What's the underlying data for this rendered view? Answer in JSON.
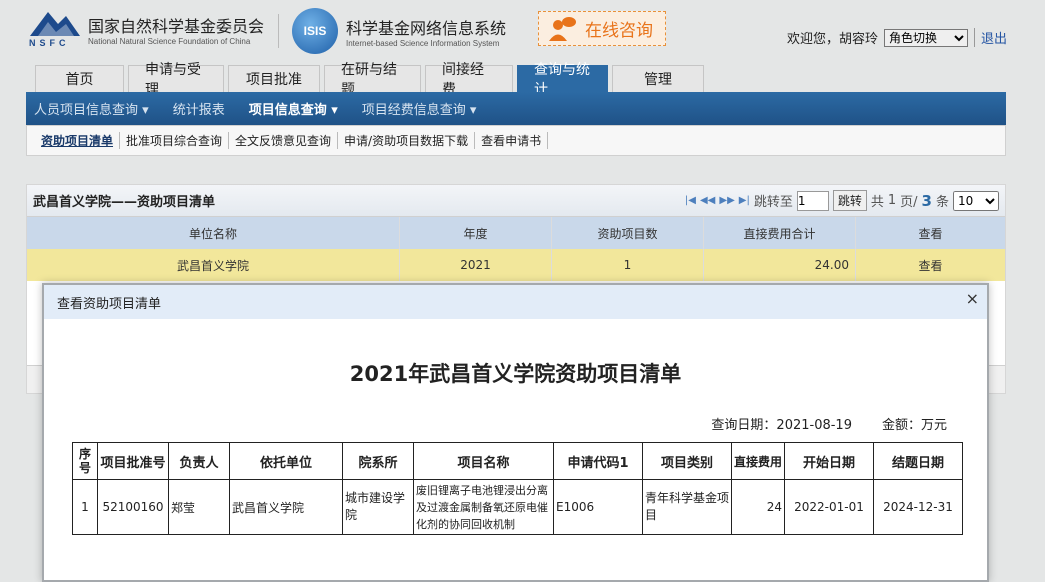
{
  "header": {
    "nsfc_abbr": "NSFC",
    "nsfc_name_cn": "国家自然科学基金委员会",
    "nsfc_name_en": "National Natural Science Foundation of China",
    "isis_abbr": "ISIS",
    "system_name_cn": "科学基金网络信息系统",
    "system_name_en": "Internet-based Science Information System",
    "consult_label": "在线咨询",
    "welcome": "欢迎您，胡容玲",
    "role_switch": "角色切换",
    "logout": "退出"
  },
  "tabs": [
    "首页",
    "申请与受理",
    "项目批准",
    "在研与结题",
    "间接经费",
    "查询与统计",
    "管理"
  ],
  "active_tab": 5,
  "nav": [
    "人员项目信息查询",
    "统计报表",
    "项目信息查询",
    "项目经费信息查询"
  ],
  "sub_nav": [
    "资助项目清单",
    "批准项目综合查询",
    "全文反馈意见查询",
    "申请/资助项目数据下载",
    "查看申请书"
  ],
  "panel": {
    "title": "武昌首义学院——资助项目清单",
    "pager": {
      "jump_to": "跳转至",
      "page_input": "1",
      "jump_button": "跳转",
      "total_prefix": "共",
      "total_pages": "1",
      "page_unit": "页/",
      "total_records": "3",
      "record_unit": "条",
      "page_size": "10"
    },
    "columns": [
      "单位名称",
      "年度",
      "资助项目数",
      "直接费用合计",
      "查看"
    ],
    "row": [
      "武昌首义学院",
      "2021",
      "1",
      "24.00",
      "查看"
    ]
  },
  "dialog": {
    "header": "查看资助项目清单",
    "close": "×",
    "title": "2021年武昌首义学院资助项目清单",
    "query_date": "查询日期：2021-08-19",
    "amount_unit": "金额：万元",
    "columns": [
      "序号",
      "项目批准号",
      "负责人",
      "依托单位",
      "院系所",
      "项目名称",
      "申请代码1",
      "项目类别",
      "直接费用",
      "开始日期",
      "结题日期"
    ],
    "rows": [
      [
        "1",
        "52100160",
        "郑莹",
        "武昌首义学院",
        "城市建设学院",
        "废旧锂离子电池锂浸出分离及过渡金属制备氧还原电催化剂的协同回收机制",
        "E1006",
        "青年科学基金项目",
        "24",
        "2022-01-01",
        "2024-12-31"
      ]
    ]
  },
  "colors": {
    "nav_blue": "#2c6aa4",
    "highlight_row": "#f2e79b",
    "consult_orange": "#e8731a"
  }
}
